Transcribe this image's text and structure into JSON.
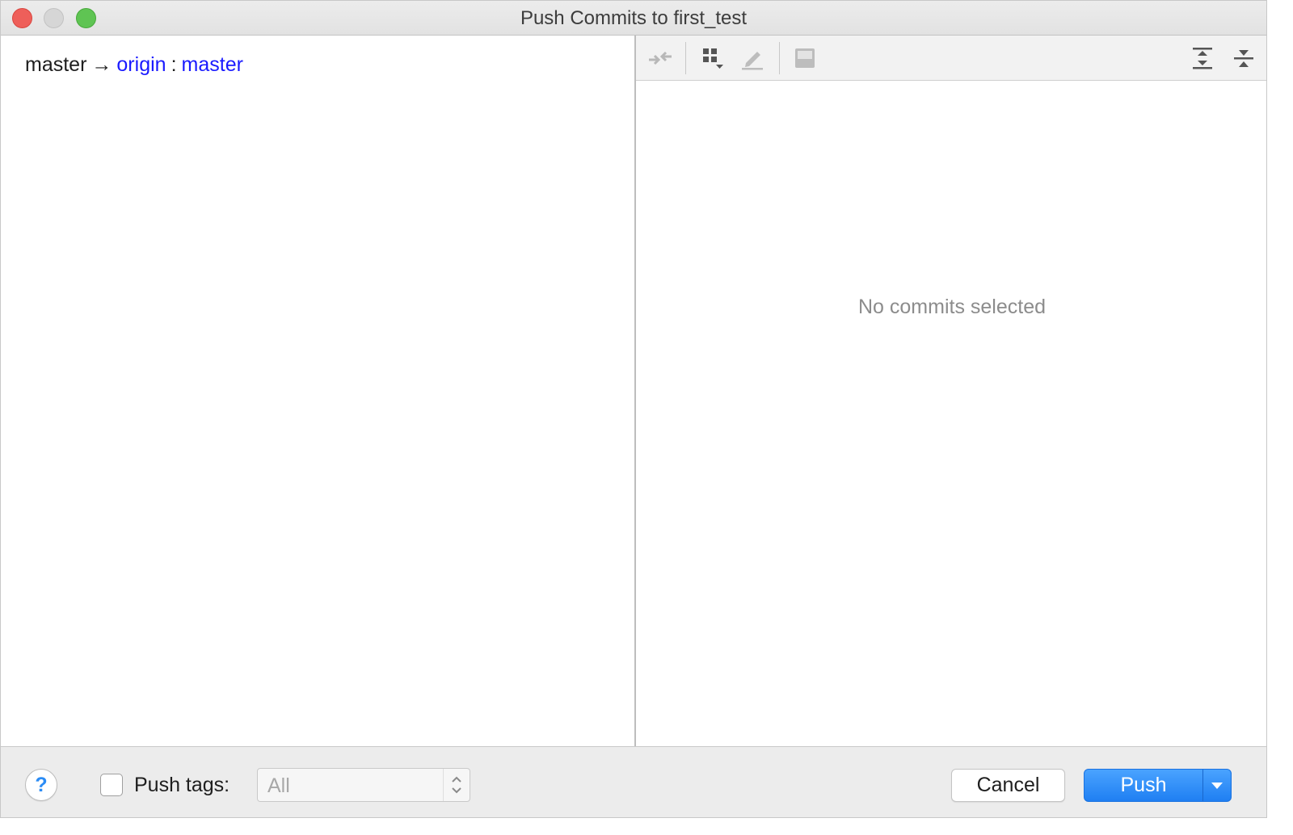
{
  "window": {
    "title": "Push Commits to first_test"
  },
  "left_pane": {
    "local_branch": "master",
    "arrow": "→",
    "remote": "origin",
    "separator": ":",
    "remote_branch": "master"
  },
  "toolbar": {
    "icons": [
      "collapse-arrows-icon",
      "group-by-icon",
      "edit-source-icon",
      "preview-diff-icon",
      "expand-all-icon",
      "collapse-all-icon"
    ]
  },
  "right_pane": {
    "empty_text": "No commits selected"
  },
  "footer": {
    "help_label": "?",
    "push_tags_label": "Push tags:",
    "push_tags_checked": false,
    "tags_select_value": "All",
    "cancel_label": "Cancel",
    "push_label": "Push"
  },
  "colors": {
    "link": "#1a1aff",
    "primary_button": "#2a8af5",
    "empty_text": "#8c8c8c"
  }
}
